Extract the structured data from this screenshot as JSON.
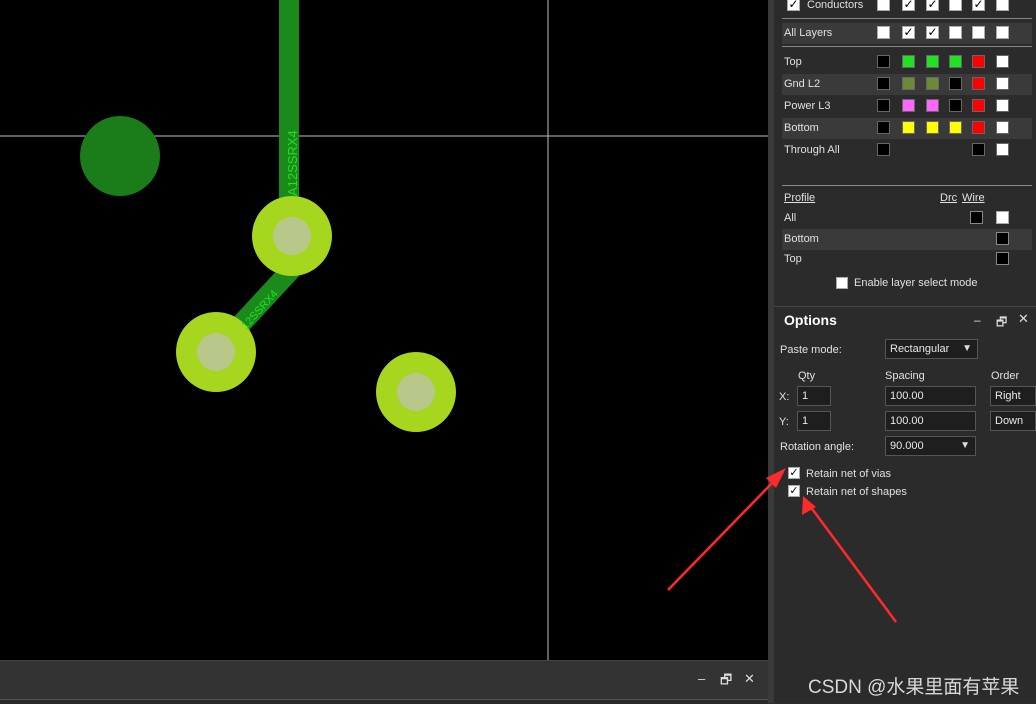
{
  "canvas": {
    "track_label_vertical": "A12SSRX4",
    "track_label_diagonal": "12SSRX4",
    "colors": {
      "track": "#1a8a1a",
      "pad": "#a6d61e",
      "pad_hole": "#b7c88a",
      "big_pad": "#1a7d1a",
      "crosshair": "#bfbfbf"
    }
  },
  "layers_panel": {
    "conductors_label": "Conductors",
    "all_layers_label": "All Layers",
    "layers": [
      {
        "name": "Top",
        "colors": [
          "#000000",
          "#22e022",
          "#22e022",
          "#22e022",
          "#ff0000",
          "#ffffff"
        ]
      },
      {
        "name": "Gnd L2",
        "colors": [
          "#000000",
          "#6a8a3a",
          "#6a8a3a",
          "#000000",
          "#ff0000",
          "#ffffff"
        ]
      },
      {
        "name": "Power L3",
        "colors": [
          "#000000",
          "#ff66ff",
          "#ff66ff",
          "#000000",
          "#ff0000",
          "#ffffff"
        ]
      },
      {
        "name": "Bottom",
        "colors": [
          "#000000",
          "#ffff00",
          "#ffff00",
          "#ffff00",
          "#ff0000",
          "#ffffff"
        ]
      },
      {
        "name": "Through All",
        "colors": [
          "#000000",
          "",
          "",
          "",
          "#000000",
          "#ffffff"
        ]
      }
    ],
    "profile_header": "Profile",
    "drc_header": "Drc",
    "wire_header": "Wire",
    "profiles": [
      "All",
      "Bottom",
      "Top"
    ],
    "enable_layer_select": "Enable layer select mode"
  },
  "options": {
    "title": "Options",
    "paste_mode_label": "Paste mode:",
    "paste_mode_value": "Rectangular",
    "qty_header": "Qty",
    "spacing_header": "Spacing",
    "order_header": "Order",
    "x_label": "X:",
    "y_label": "Y:",
    "x_qty": "1",
    "y_qty": "1",
    "x_spacing": "100.00",
    "y_spacing": "100.00",
    "x_order": "Right",
    "y_order": "Down",
    "rotation_label": "Rotation angle:",
    "rotation_value": "90.000",
    "retain_vias": "Retain net of vias",
    "retain_shapes": "Retain net of shapes"
  },
  "window_buttons": {
    "minimize": "–",
    "restore": "🗗",
    "close": "✕"
  },
  "watermark": "CSDN @水果里面有苹果",
  "annotation_color": "#ff2a2a"
}
